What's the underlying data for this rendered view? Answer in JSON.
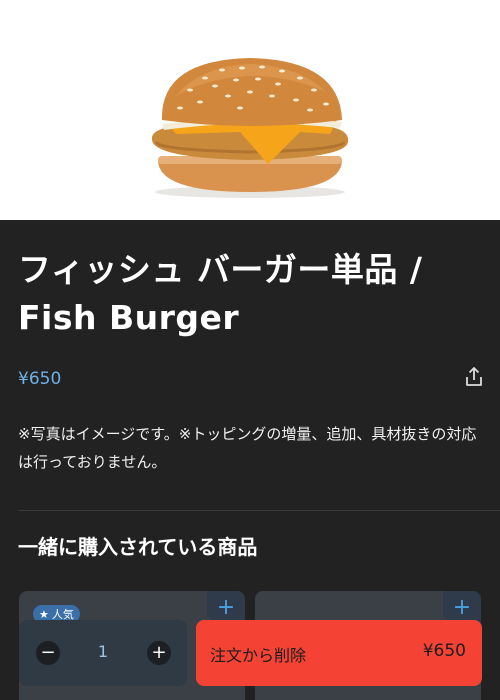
{
  "product": {
    "title": "フィッシュ バーガー単品 / Fish Burger",
    "price": "¥650",
    "description": "※写真はイメージです。※トッピングの増量、追加、具材抜きの対応は行っておりません。"
  },
  "related": {
    "section_title": "一緒に購入されている商品",
    "cards": [
      {
        "badge": "人気",
        "add_label": "+"
      },
      {
        "add_label": "+"
      }
    ]
  },
  "order_bar": {
    "minus_label": "−",
    "quantity": "1",
    "plus_label": "+",
    "remove_label": "注文から削除",
    "total": "¥650"
  },
  "colors": {
    "accent_price": "#6fb1e6",
    "remove_button": "#f44335",
    "background": "#222222"
  },
  "icons": [
    "burger-image",
    "share-icon",
    "star-icon"
  ]
}
